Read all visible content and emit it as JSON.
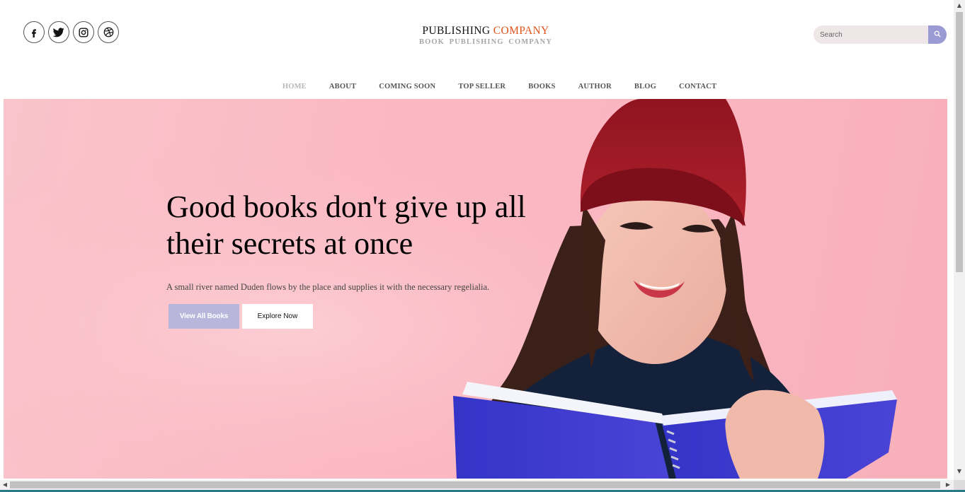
{
  "social": [
    {
      "name": "facebook-icon"
    },
    {
      "name": "twitter-icon"
    },
    {
      "name": "instagram-icon"
    },
    {
      "name": "dribbble-icon"
    }
  ],
  "logo": {
    "main": "PUBLISHING ",
    "accent": "COMPANY",
    "sub": "BOOK  PUBLISHING  COMPANY",
    "accent_color": "#e0541c"
  },
  "search": {
    "placeholder": "Search",
    "button_color": "#9b9bd3"
  },
  "nav": {
    "items": [
      {
        "label": "HOME",
        "active": true
      },
      {
        "label": "ABOUT"
      },
      {
        "label": "COMING SOON"
      },
      {
        "label": "TOP SELLER"
      },
      {
        "label": "BOOKS"
      },
      {
        "label": "AUTHOR"
      },
      {
        "label": "BLOG"
      },
      {
        "label": "CONTACT"
      }
    ]
  },
  "hero": {
    "title": "Good books don't give up all their secrets at once",
    "text": "A small river named Duden flows by the place and supplies it with the necessary regelialia.",
    "primary_button": "View All Books",
    "secondary_button": "Explore Now",
    "background_color": "#fbb8c2",
    "primary_button_color": "#b9b6dc"
  },
  "scrollbars": {
    "up_glyph": "▲",
    "down_glyph": "▼",
    "left_glyph": "◀",
    "right_glyph": "▶"
  }
}
